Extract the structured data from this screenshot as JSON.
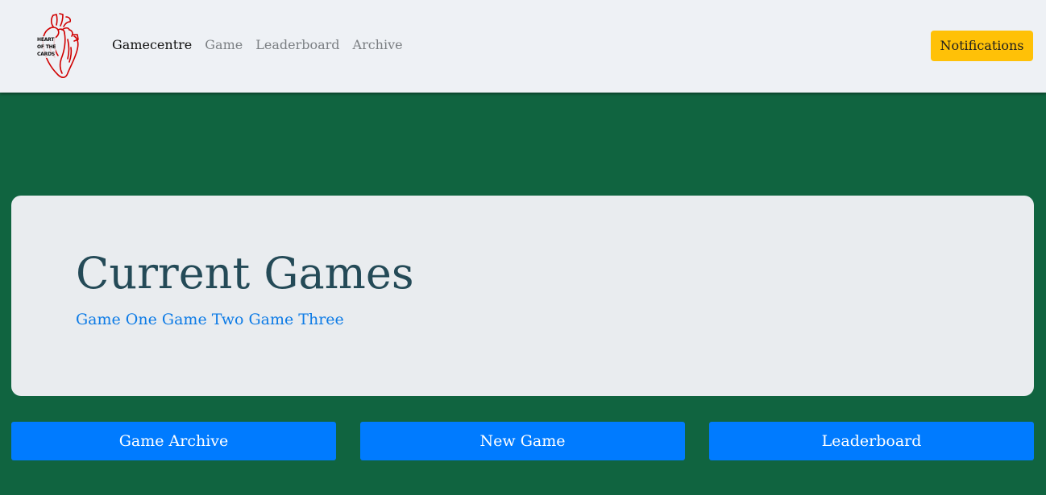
{
  "navbar": {
    "logo": {
      "icon": "anatomical-heart-logo",
      "lines": [
        "HEART",
        "OF THE",
        "CARDS"
      ],
      "color": "#d00000"
    },
    "links": [
      {
        "label": "Gamecentre",
        "active": true
      },
      {
        "label": "Game",
        "active": false
      },
      {
        "label": "Leaderboard",
        "active": false
      },
      {
        "label": "Archive",
        "active": false
      }
    ],
    "notifications_label": "Notifications"
  },
  "main": {
    "title": "Current Games",
    "games": [
      "Game One",
      "Game Two",
      "Game Three"
    ]
  },
  "actions": {
    "archive_label": "Game Archive",
    "new_game_label": "New Game",
    "leaderboard_label": "Leaderboard"
  },
  "colors": {
    "background": "#106440",
    "navbar": "#eef1f5",
    "jumbotron": "#e9ecef",
    "primary_button": "#007bff",
    "warning_button": "#ffc107",
    "title_text": "#244a57",
    "link_text": "#0d7be6"
  }
}
